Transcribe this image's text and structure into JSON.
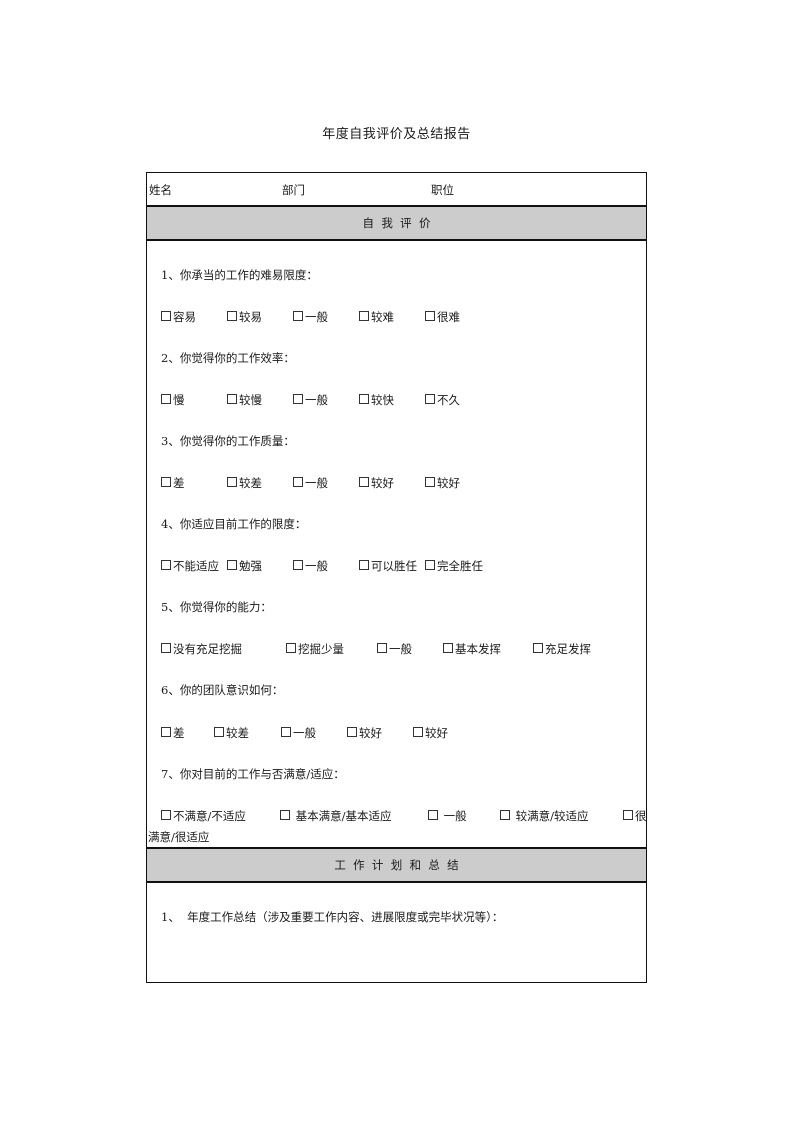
{
  "document": {
    "title": "年度自我评价及总结报告"
  },
  "info_row": {
    "name_label": "姓名",
    "dept_label": "部门",
    "position_label": "职位"
  },
  "sections": {
    "self_evaluation": "自  我  评  价",
    "work_plan_summary": "工  作  计  划  和  总  结"
  },
  "questions": [
    {
      "label": "1、你承当的工作的难易限度：",
      "options": [
        "容易",
        "较易",
        "一般",
        "较难",
        "很难"
      ]
    },
    {
      "label": "2、你觉得你的工作效率：",
      "options": [
        "慢",
        "较慢",
        "一般",
        "较快",
        "不久"
      ]
    },
    {
      "label": "3、你觉得你的工作质量：",
      "options": [
        "差",
        "较差",
        "一般",
        "较好",
        "较好"
      ]
    },
    {
      "label": "4、你适应目前工作的限度：",
      "options": [
        "不能适应",
        "勉强",
        "一般",
        "可以胜任",
        "完全胜任"
      ]
    },
    {
      "label": "5、你觉得你的能力：",
      "options": [
        "没有充足挖掘",
        "挖掘少量",
        "一般",
        "基本发挥",
        "充足发挥"
      ]
    },
    {
      "label": "6、你的团队意识如何：",
      "options": [
        "差",
        "较差",
        "一般",
        "较好",
        "较好"
      ]
    },
    {
      "label": "7、你对目前的工作与否满意/适应：",
      "options": [
        "不满意/不适应",
        " 基本满意/基本适应",
        " 一般",
        " 较满意/较适应",
        "很"
      ],
      "wrap_continuation": "满意/很适应"
    }
  ],
  "summary": {
    "item_1": "1、  年度工作总结（涉及重要工作内容、进展限度或完毕状况等）："
  }
}
